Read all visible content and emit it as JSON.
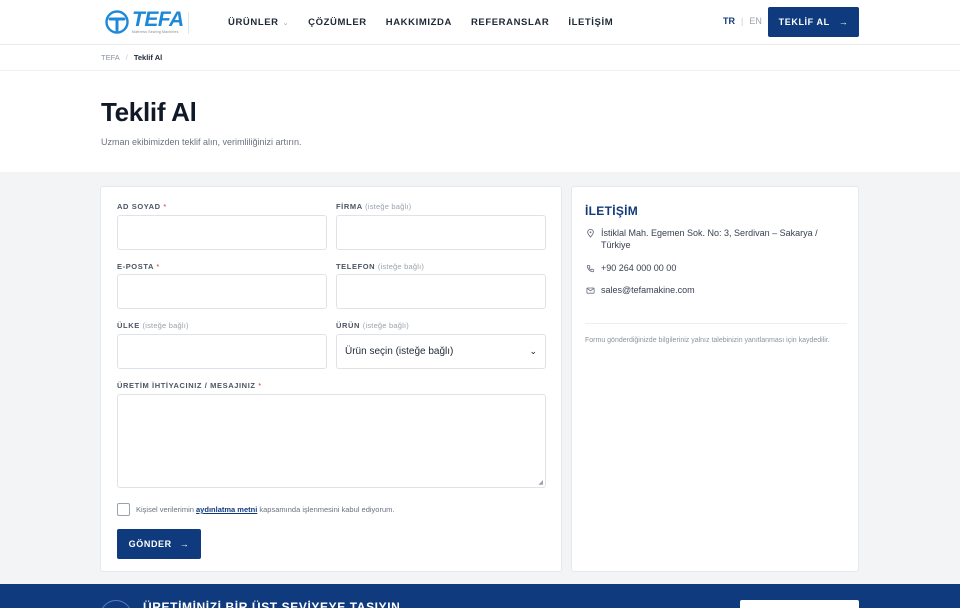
{
  "header": {
    "logo_text": "TEFA",
    "logo_tagline": "Mattress Sewing Machines",
    "nav": [
      {
        "label": "ÜRÜNLER",
        "has_dropdown": true
      },
      {
        "label": "ÇÖZÜMLER",
        "has_dropdown": false
      },
      {
        "label": "HAKKIMIZDA",
        "has_dropdown": false
      },
      {
        "label": "REFERANSLAR",
        "has_dropdown": false
      },
      {
        "label": "İLETİŞİM",
        "has_dropdown": false
      }
    ],
    "lang_active": "TR",
    "lang_separator": "|",
    "lang_other": "EN",
    "cta_label": "TEKLİF AL",
    "cta_arrow": "→"
  },
  "breadcrumb": {
    "home": "TEFA",
    "separator": "/",
    "current": "Teklif Al"
  },
  "hero": {
    "title": "Teklif Al",
    "subtitle": "Uzman ekibimizden teklif alın, verimliliğinizi artırın."
  },
  "form": {
    "required_mark": "*",
    "optional_text": "(isteğe bağlı)",
    "name_label": "AD SOYAD",
    "company_label": "FİRMA",
    "email_label": "E-POSTA",
    "phone_label": "TELEFON",
    "country_label": "ÜLKE",
    "product_label": "ÜRÜN",
    "product_selected": "Ürün seçin (isteğe bağlı)",
    "message_label": "ÜRETİM İHTİYACINIZ / MESAJINIZ",
    "consent_before": "Kişisel verilerimin ",
    "consent_link": "aydınlatma metni",
    "consent_after": " kapsamında işlenmesini kabul ediyorum.",
    "submit_label": "GÖNDER",
    "submit_arrow": "→"
  },
  "contact": {
    "title": "İLETİŞİM",
    "address": "İstiklal Mah. Egemen Sok. No: 3, Serdivan – Sakarya / Türkiye",
    "phone": "+90 264 000 00 00",
    "email": "sales@tefamakine.com",
    "note": "Formu gönderdiğinizde bilgileriniz yalnız talebinizin yanıtlanması için kaydedilir."
  },
  "footer": {
    "title": "ÜRETİMİNİZİ BİR ÜST SEVİYEYE TAŞIYIN"
  },
  "colors": {
    "primary": "#0f3a7d",
    "logo_blue": "#1e88d8",
    "required": "#d4342f",
    "background_gray": "#f3f4f6"
  },
  "icons": [
    "logo-mark-icon",
    "chevron-down-icon",
    "arrow-right-icon",
    "map-pin-icon",
    "phone-icon",
    "mail-icon",
    "resize-grip-icon"
  ]
}
